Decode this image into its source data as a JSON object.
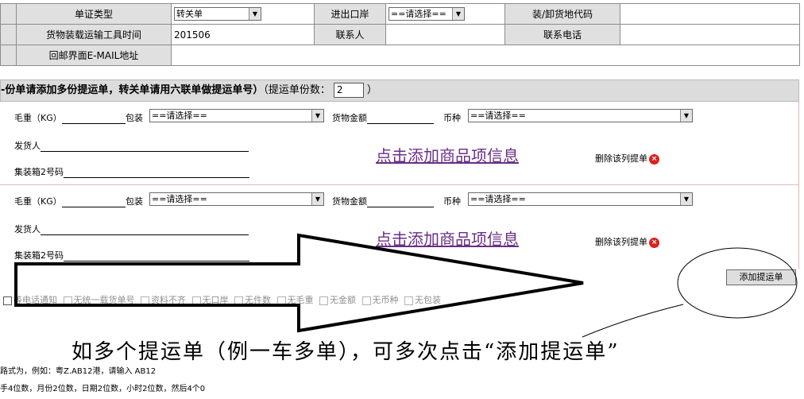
{
  "top_table": {
    "doc_type_label": "单证类型",
    "doc_type_value": "转关单",
    "port_label": "进出口岸",
    "port_value": "==请选择==",
    "load_code_label": "装/卸货地代码",
    "load_time_label": "货物装载运输工具时间",
    "load_time_value": "201506",
    "contact_label": "联系人",
    "phone_label": "联系电话",
    "email_label": "回邮界面E-MAIL地址"
  },
  "section": {
    "heading": "-份单请添加多份提运单，转关单请用六联单做提运单号）",
    "count_label_open": "（提运单份数：",
    "count_value": "2",
    "count_label_close": "）"
  },
  "bill_fields": {
    "gross_weight": "毛重（KG）",
    "package": "包装",
    "package_select": "==请选择==",
    "goods_amount": "货物金额",
    "currency": "币种",
    "currency_select": "==请选择==",
    "shipper": "发货人",
    "container2": "集装箱2号码",
    "add_goods_link": "点击添加商品项信息",
    "delete_bill": "删除该列提单"
  },
  "add_bill_button": "添加提运单",
  "checkboxes": [
    "等电话通知",
    "无统一载货单号",
    "资料不齐",
    "无口岸",
    "无件数",
    "无毛重",
    "无金额",
    "无币种",
    "无包装"
  ],
  "caption": "如多个提运单（例一车多单），可多次点击“添加提运单”",
  "hints": [
    "路式为，例如：粤Z.AB12港，请输入 AB12",
    "手4位数，月份2位数，日期2位数，小时2位数，然后4个0"
  ],
  "icons": {
    "delete": "close-circle-icon",
    "dropdown": "chevron-down-icon"
  },
  "colors": {
    "link": "#6a2f86",
    "delete_icon": "#d9231f",
    "header_bg": "#dcdcdc"
  }
}
